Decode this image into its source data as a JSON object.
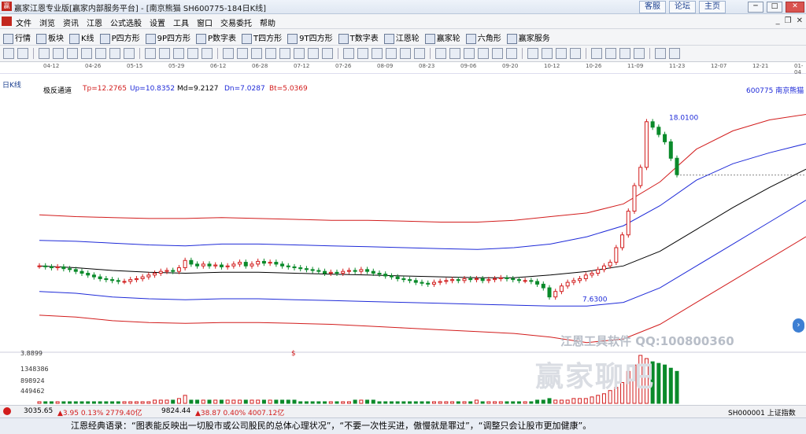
{
  "window": {
    "title": "赢家江恩专业版[赢家内部服务平台] - [南京熊猫  SH600775-184日K线]",
    "top_buttons": [
      "客服",
      "论坛",
      "主页"
    ]
  },
  "menu": [
    "文件",
    "浏览",
    "资讯",
    "江恩",
    "公式选股",
    "设置",
    "工具",
    "窗口",
    "交易委托",
    "帮助"
  ],
  "toolbar1": [
    "行情",
    "板块",
    "K线",
    "P四方形",
    "9P四方形",
    "P数字表",
    "T四方形",
    "9T四方形",
    "T数字表",
    "江恩轮",
    "赢家轮",
    "六角形",
    "赢家服务"
  ],
  "date_axis": [
    "04-12",
    "04-26",
    "05-15",
    "05-29",
    "06-12",
    "06-28",
    "07-12",
    "07-26",
    "08-09",
    "08-23",
    "09-06",
    "09-20",
    "10-12",
    "10-26",
    "11-09",
    "11-23",
    "12-07",
    "12-21",
    "01-04"
  ],
  "panel": {
    "period_label": "日K线",
    "indicator_name": "极反通道",
    "tp": "Tp=12.2765",
    "up": "Up=10.8352",
    "md": "Md=9.2127",
    "dn": "Dn=7.0287",
    "bt": "Bt=5.0369",
    "stock": "600775  南京熊猫",
    "high_label": "18.0100",
    "low_label": "7.6300"
  },
  "volume_scale": [
    "3.8899",
    "1348386",
    "898924",
    "449462"
  ],
  "volume_marker": "$",
  "watermarks": [
    "江恩工具软件  QQ:100800360",
    "赢家聊吧"
  ],
  "status": {
    "idx1_value": "3035.65",
    "idx1_change": "▲3.95 0.13% 2779.40亿",
    "idx2_value": "9824.44",
    "idx2_change": "▲38.87 0.40% 4007.12亿",
    "index_name": "SH000001 上证指数"
  },
  "quote": "江恩经典语录：“图表能反映出一切股市或公司股民的总体心理状况”，“不要一次性买进，傲慢就是罪过”，“调整只会让股市更加健康”。",
  "colors": {
    "line_tp": "#d21c1c",
    "line_up": "#1e2ad8",
    "line_md": "#000000",
    "candle_up": "#d21c1c",
    "candle_down": "#0a8a2a",
    "volume_up": "#d21c1c",
    "volume_down": "#0a8a2a"
  },
  "chart_data": {
    "type": "candlestick_channel",
    "series": [
      {
        "name": "Tp",
        "color": "#d21c1c"
      },
      {
        "name": "Up",
        "color": "#1e2ad8"
      },
      {
        "name": "Md",
        "color": "#000000"
      },
      {
        "name": "Dn",
        "color": "#1e2ad8"
      },
      {
        "name": "Bt",
        "color": "#d21c1c"
      }
    ],
    "candles_close": [
      9.6,
      9.55,
      9.5,
      9.55,
      9.45,
      9.4,
      9.3,
      9.2,
      9.1,
      9.0,
      8.9,
      8.85,
      8.8,
      8.75,
      8.75,
      8.85,
      8.9,
      9.0,
      9.1,
      9.2,
      9.3,
      9.35,
      9.3,
      9.5,
      9.9,
      9.7,
      9.6,
      9.7,
      9.6,
      9.65,
      9.55,
      9.6,
      9.7,
      9.8,
      9.6,
      9.7,
      9.85,
      9.75,
      9.8,
      9.7,
      9.6,
      9.55,
      9.5,
      9.45,
      9.4,
      9.35,
      9.3,
      9.2,
      9.25,
      9.2,
      9.3,
      9.35,
      9.3,
      9.4,
      9.3,
      9.2,
      9.15,
      9.05,
      9.0,
      8.9,
      8.85,
      8.8,
      8.7,
      8.65,
      8.6,
      8.7,
      8.75,
      8.8,
      8.85,
      8.8,
      8.9,
      8.85,
      8.9,
      8.8,
      8.85,
      8.9,
      8.95,
      8.9,
      8.85,
      8.8,
      8.8,
      8.75,
      8.6,
      8.4,
      7.9,
      8.2,
      8.5,
      8.7,
      8.8,
      8.9,
      9.1,
      9.2,
      9.4,
      9.6,
      9.8,
      10.6,
      11.3,
      12.6,
      14.0,
      15.0,
      17.5,
      17.2,
      16.8,
      16.4,
      15.5,
      14.6
    ],
    "channel": {
      "tp": [
        12.4,
        12.3,
        12.25,
        12.2,
        12.2,
        12.25,
        12.2,
        12.15,
        12.1,
        12.1,
        12.05,
        12.0,
        12.0,
        12.1,
        12.3,
        12.5,
        13.0,
        14.2,
        16.0,
        17.0,
        17.6,
        17.9
      ],
      "up": [
        11.0,
        10.95,
        10.85,
        10.75,
        10.7,
        10.8,
        10.8,
        10.75,
        10.7,
        10.65,
        10.6,
        10.55,
        10.5,
        10.6,
        10.8,
        11.2,
        11.8,
        12.9,
        14.3,
        15.2,
        15.8,
        16.3
      ],
      "md": [
        9.6,
        9.5,
        9.35,
        9.25,
        9.2,
        9.25,
        9.25,
        9.2,
        9.15,
        9.1,
        9.05,
        9.0,
        8.95,
        8.95,
        9.1,
        9.3,
        9.6,
        10.4,
        11.6,
        12.8,
        13.9,
        14.9
      ],
      "dn": [
        8.2,
        8.1,
        7.9,
        7.8,
        7.75,
        7.8,
        7.8,
        7.75,
        7.7,
        7.65,
        7.6,
        7.55,
        7.5,
        7.45,
        7.4,
        7.4,
        7.6,
        8.4,
        9.6,
        10.8,
        12.0,
        13.2
      ],
      "bt": [
        6.9,
        6.8,
        6.6,
        6.5,
        6.45,
        6.5,
        6.5,
        6.45,
        6.4,
        6.3,
        6.2,
        6.1,
        6.0,
        5.9,
        5.7,
        5.4,
        5.6,
        6.4,
        7.6,
        8.8,
        10.0,
        11.2
      ]
    },
    "ylim": [
      5.0,
      19.0
    ],
    "volumes": [
      1,
      1,
      1,
      1,
      1,
      1,
      1,
      1,
      1,
      1,
      1,
      1,
      1,
      1,
      1,
      1,
      1,
      1,
      1,
      2,
      2,
      2,
      2,
      3,
      5,
      2,
      2,
      2,
      2,
      2,
      2,
      2,
      2,
      2,
      2,
      2,
      2,
      2,
      2,
      2,
      2,
      2,
      2,
      1,
      1,
      1,
      1,
      1,
      1,
      1,
      1,
      1,
      2,
      2,
      2,
      2,
      1,
      1,
      1,
      1,
      1,
      1,
      1,
      1,
      1,
      1,
      1,
      1,
      1,
      1,
      1,
      1,
      2,
      1,
      1,
      1,
      1,
      1,
      1,
      1,
      1,
      1,
      2,
      2,
      3,
      2,
      2,
      2,
      3,
      3,
      3,
      4,
      5,
      6,
      8,
      10,
      13,
      20,
      24,
      30,
      28,
      26,
      25,
      24,
      22,
      20
    ],
    "volume_max": 30
  }
}
